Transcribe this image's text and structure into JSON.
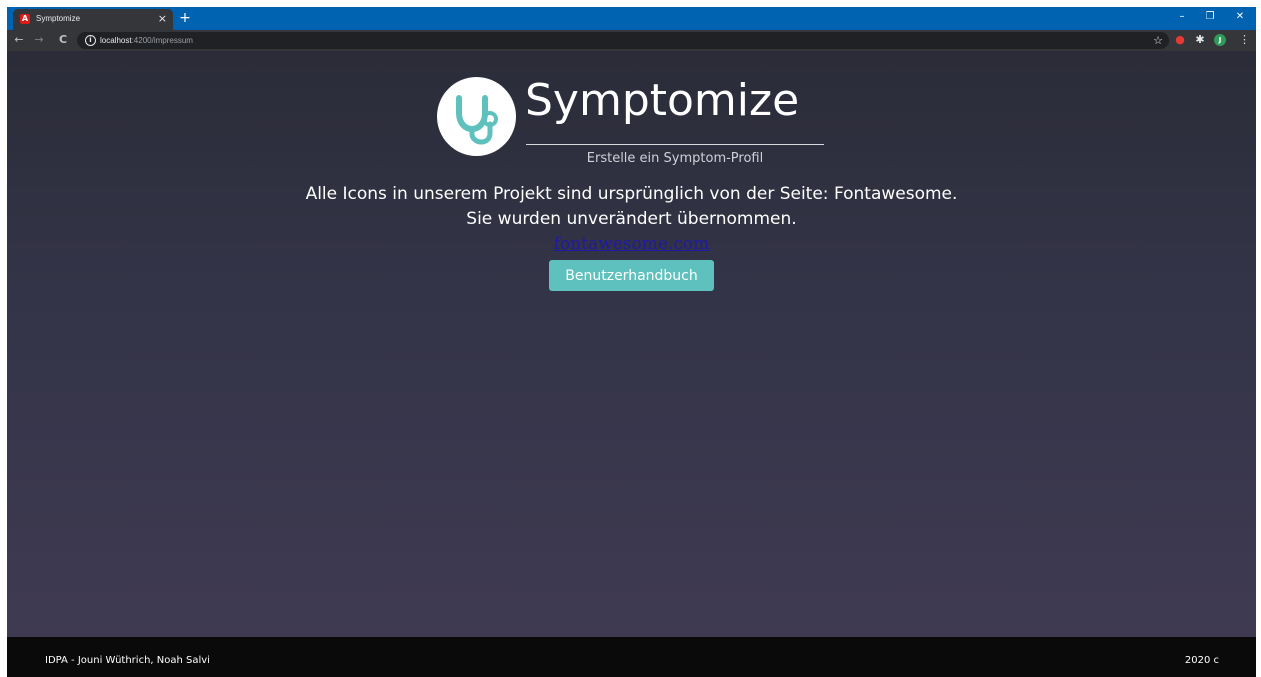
{
  "browser": {
    "tab": {
      "title": "Symptomize",
      "favicon": "A",
      "close_glyph": "×"
    },
    "new_tab_glyph": "+",
    "window_controls": {
      "minimize": "–",
      "restore": "❐",
      "close": "✕"
    },
    "nav": {
      "back": "←",
      "forward": "→",
      "reload": "C"
    },
    "address": {
      "info_glyph": "i",
      "host": "localhost",
      "rest": ":4200/impressum"
    },
    "bookmark_glyph": "☆",
    "extensions": [
      {
        "name": "red-extension-icon",
        "glyph": "●",
        "color": "#e53935"
      },
      {
        "name": "puzzle-extensions-icon",
        "glyph": "✱",
        "color": "#e8eaed"
      },
      {
        "name": "profile-avatar",
        "glyph": "J",
        "color": "#2e9b5a"
      }
    ],
    "menu_glyph": "⋮",
    "colors": {
      "titlebar": "#0063b1",
      "toolbar": "#35363a"
    }
  },
  "header": {
    "brand": "Symptomize",
    "subtitle": "Erstelle ein Symptom-Profil",
    "logo_icon": "stethoscope-icon",
    "accent_color": "#5fc1bd"
  },
  "main": {
    "notice_line1": "Alle Icons in unserem Projekt sind ursprünglich von der Seite: Fontawesome.",
    "notice_line2": "Sie wurden unverändert übernommen.",
    "link_text": "fontawesome.com",
    "button_label": "Benutzerhandbuch"
  },
  "footer": {
    "credits": "IDPA - Jouni Wüthrich, Noah Salvi",
    "year": "2020 c"
  }
}
